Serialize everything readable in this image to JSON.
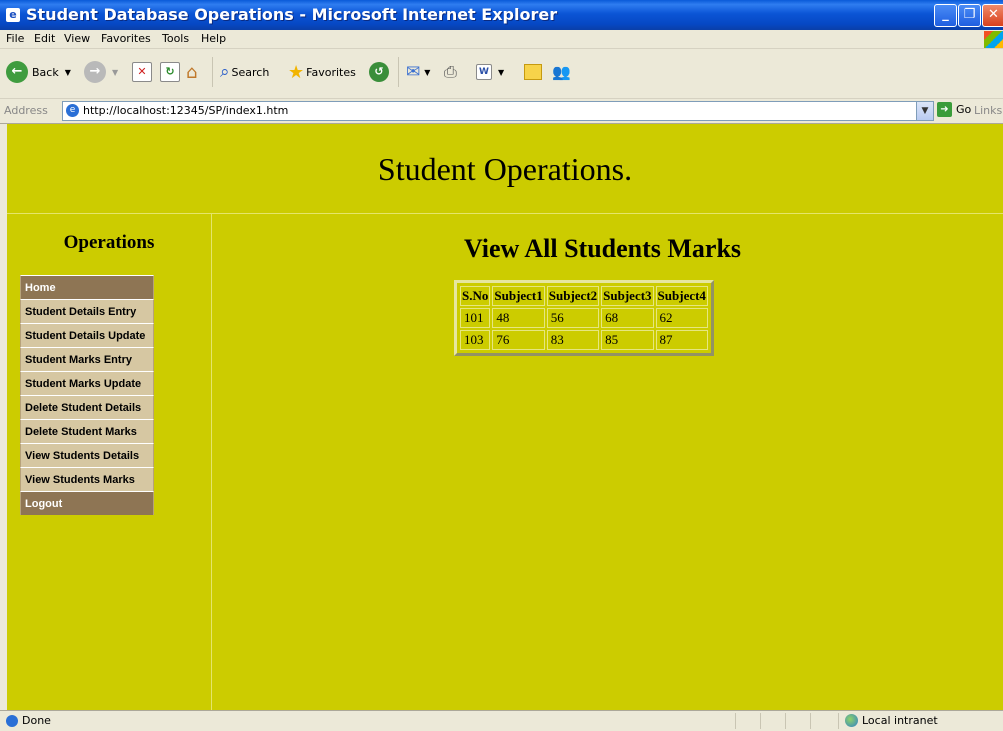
{
  "window": {
    "title": "Student Database Operations - Microsoft Internet Explorer",
    "minimize": "_",
    "maximize": "❐",
    "close": "✕"
  },
  "menu": [
    "File",
    "Edit",
    "View",
    "Favorites",
    "Tools",
    "Help"
  ],
  "toolbar": {
    "back": "Back",
    "search": "Search",
    "favorites": "Favorites"
  },
  "address": {
    "label": "Address",
    "url": "http://localhost:12345/SP/index1.htm",
    "go": "Go",
    "links": "Links"
  },
  "page": {
    "title": "Student Operations.",
    "sidebar_heading": "Operations",
    "nav": [
      {
        "label": "Home",
        "style": "dark"
      },
      {
        "label": "Student Details Entry",
        "style": "light"
      },
      {
        "label": "Student Details Update",
        "style": "light"
      },
      {
        "label": "Student Marks Entry",
        "style": "light"
      },
      {
        "label": "Student Marks Update",
        "style": "light"
      },
      {
        "label": "Delete Student Details",
        "style": "light"
      },
      {
        "label": "Delete Student Marks",
        "style": "light"
      },
      {
        "label": "View Students Details",
        "style": "light"
      },
      {
        "label": "View Students Marks",
        "style": "light"
      },
      {
        "label": "Logout",
        "style": "dark"
      }
    ],
    "content_title": "View All Students Marks",
    "table": {
      "headers": [
        "S.No",
        "Subject1",
        "Subject2",
        "Subject3",
        "Subject4"
      ],
      "rows": [
        [
          "101",
          "48",
          "56",
          "68",
          "62"
        ],
        [
          "103",
          "76",
          "83",
          "85",
          "87"
        ]
      ]
    }
  },
  "status": {
    "left": "Done",
    "zone": "Local intranet"
  },
  "colors": {
    "page_bg": "#cccc00",
    "nav_light": "#d6c7a2",
    "nav_dark": "#8e7554",
    "titlebar": "#0a5ad8"
  }
}
